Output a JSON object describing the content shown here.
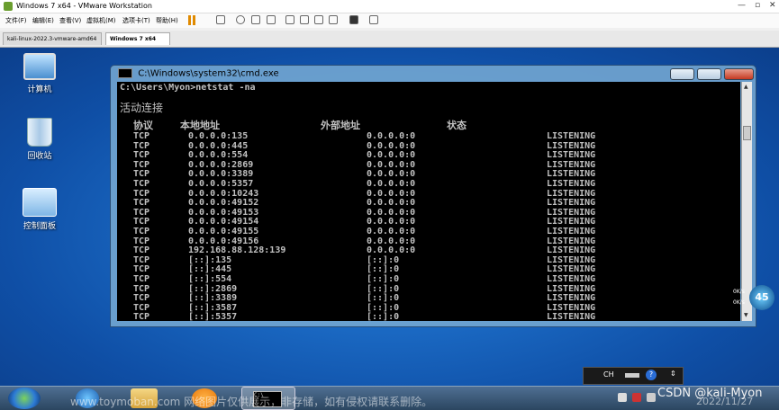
{
  "vmware": {
    "title": "Windows 7 x64 - VMware Workstation",
    "menu": [
      "文件(F)",
      "编辑(E)",
      "查看(V)",
      "虚拟机(M)",
      "选项卡(T)",
      "帮助(H)"
    ],
    "tabs": [
      {
        "label": "kali-linux-2022.3-vmware-amd64",
        "active": false
      },
      {
        "label": "Windows 7 x64",
        "active": true
      }
    ]
  },
  "desktop": {
    "icons": [
      {
        "label": "计算机",
        "icon": "computer-icon"
      },
      {
        "label": "回收站",
        "icon": "recycle-bin-icon"
      },
      {
        "label": "控制面板",
        "icon": "control-panel-icon"
      }
    ]
  },
  "cmd": {
    "title": "C:\\Windows\\system32\\cmd.exe",
    "prompt": "C:\\Users\\Myon>netstat -na",
    "section": "活动连接",
    "headers": {
      "proto": "协议",
      "local": "本地地址",
      "foreign": "外部地址",
      "state": "状态"
    },
    "rows": [
      [
        "TCP",
        "0.0.0.0:135",
        "0.0.0.0:0",
        "LISTENING"
      ],
      [
        "TCP",
        "0.0.0.0:445",
        "0.0.0.0:0",
        "LISTENING"
      ],
      [
        "TCP",
        "0.0.0.0:554",
        "0.0.0.0:0",
        "LISTENING"
      ],
      [
        "TCP",
        "0.0.0.0:2869",
        "0.0.0.0:0",
        "LISTENING"
      ],
      [
        "TCP",
        "0.0.0.0:3389",
        "0.0.0.0:0",
        "LISTENING"
      ],
      [
        "TCP",
        "0.0.0.0:5357",
        "0.0.0.0:0",
        "LISTENING"
      ],
      [
        "TCP",
        "0.0.0.0:10243",
        "0.0.0.0:0",
        "LISTENING"
      ],
      [
        "TCP",
        "0.0.0.0:49152",
        "0.0.0.0:0",
        "LISTENING"
      ],
      [
        "TCP",
        "0.0.0.0:49153",
        "0.0.0.0:0",
        "LISTENING"
      ],
      [
        "TCP",
        "0.0.0.0:49154",
        "0.0.0.0:0",
        "LISTENING"
      ],
      [
        "TCP",
        "0.0.0.0:49155",
        "0.0.0.0:0",
        "LISTENING"
      ],
      [
        "TCP",
        "0.0.0.0:49156",
        "0.0.0.0:0",
        "LISTENING"
      ],
      [
        "TCP",
        "192.168.88.128:139",
        "0.0.0.0:0",
        "LISTENING"
      ],
      [
        "TCP",
        "[::]:135",
        "[::]:0",
        "LISTENING"
      ],
      [
        "TCP",
        "[::]:445",
        "[::]:0",
        "LISTENING"
      ],
      [
        "TCP",
        "[::]:554",
        "[::]:0",
        "LISTENING"
      ],
      [
        "TCP",
        "[::]:2869",
        "[::]:0",
        "LISTENING"
      ],
      [
        "TCP",
        "[::]:3389",
        "[::]:0",
        "LISTENING"
      ],
      [
        "TCP",
        "[::]:3587",
        "[::]:0",
        "LISTENING"
      ],
      [
        "TCP",
        "[::]:5357",
        "[::]:0",
        "LISTENING"
      ]
    ]
  },
  "gadget": {
    "value": "45",
    "labels": [
      "0K/s",
      "0K/s"
    ]
  },
  "langbar": {
    "label": "CH",
    "help": "?"
  },
  "overlay": {
    "watermark": "www.toymoban.com 网络图片仅供展示，非存储，如有侵权请联系删除。",
    "csdn": "CSDN @kali-Myon",
    "date": "2022/11/27"
  }
}
